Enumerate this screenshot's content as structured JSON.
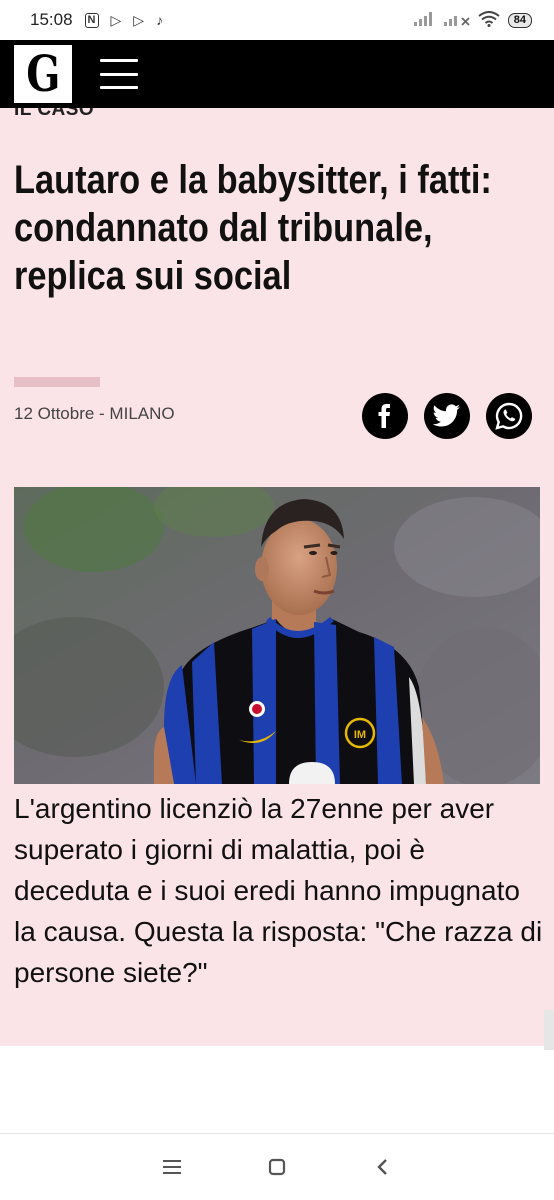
{
  "status_bar": {
    "time": "15:08",
    "battery": "84"
  },
  "header": {
    "logo_letter": "G"
  },
  "article": {
    "kicker": "IL CASO",
    "headline": "Lautaro e la babysitter, i fatti: condannato dal tribunale, replica sui social",
    "dateline": "12 Ottobre - MILANO",
    "summary": "L'argentino licenziò la 27enne per aver superato i giorni di malattia, poi è deceduta e i suoi eredi hanno impugnato la causa. Questa la risposta: \"Che razza di persone siete?\""
  },
  "colors": {
    "article_background": "#fbe4e8",
    "header_background": "#000000",
    "accent_kicker": "#e0591a",
    "jersey_blue": "#1d3fb0",
    "jersey_black": "#0d0d12"
  },
  "icons": {
    "share": [
      "facebook-icon",
      "twitter-icon",
      "whatsapp-icon"
    ],
    "nav": [
      "recents-icon",
      "home-icon",
      "back-icon"
    ]
  }
}
